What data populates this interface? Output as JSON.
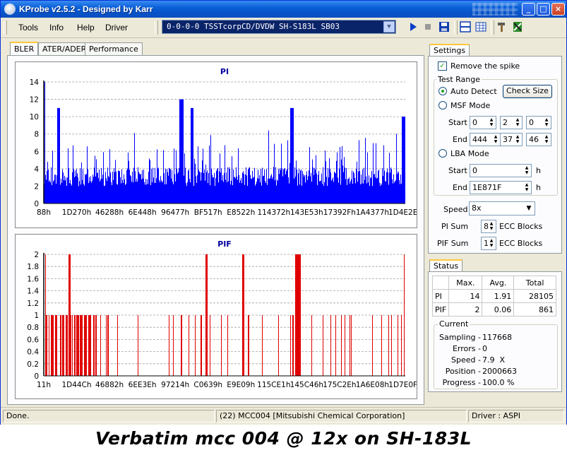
{
  "window": {
    "title": "KProbe v2.5.2 - Designed by Karr"
  },
  "menu": {
    "items": [
      "Tools",
      "Info",
      "Help",
      "Driver"
    ]
  },
  "toolbar": {
    "drive": "0-0-0-0 TSSTcorpCD/DVDW SH-S183L SB03"
  },
  "tabs": [
    "BLER",
    "ATER/ADER",
    "Performance"
  ],
  "pi_chart": {
    "title": "PI",
    "yticks": [
      "0",
      "2",
      "4",
      "6",
      "8",
      "10",
      "12",
      "14"
    ],
    "xticks": [
      "88h",
      "1D270h",
      "46288h",
      "6E448h",
      "96477h",
      "BF517h",
      "E8522h",
      "114372h",
      "143E53h",
      "17392Fh",
      "1A4377h",
      "1D4E2Eh"
    ],
    "color": "#0000ff"
  },
  "pif_chart": {
    "title": "PIF",
    "yticks": [
      "0",
      "0.2",
      "0.4",
      "0.6",
      "0.8",
      "1",
      "1.2",
      "1.4",
      "1.6",
      "1.8",
      "2"
    ],
    "xticks": [
      "11h",
      "1D44Ch",
      "46882h",
      "6EE3Eh",
      "97214h",
      "C0639h",
      "E9E09h",
      "115CE1h",
      "145C46h",
      "175C2Eh",
      "1A6E08h",
      "1D7E0Fh"
    ],
    "color": "#e00000"
  },
  "chart_data": [
    {
      "type": "area",
      "title": "PI",
      "ylim": [
        0,
        14
      ],
      "x_ticks": [
        "88h",
        "1D270h",
        "46288h",
        "6E448h",
        "96477h",
        "BF517h",
        "E8522h",
        "114372h",
        "143E53h",
        "17392Fh",
        "1A4377h",
        "1D4E2Eh"
      ],
      "baseline_range": [
        2,
        5
      ],
      "peaks": [
        {
          "x": "88h",
          "value": 14
        },
        {
          "x": "1D270h",
          "value": 11
        },
        {
          "x": "BF517h",
          "value": 12
        },
        {
          "x": "143E53h",
          "value": 11
        },
        {
          "x": "1D4E2Eh",
          "value": 10
        }
      ],
      "grid": true
    },
    {
      "type": "bar",
      "title": "PIF",
      "ylim": [
        0,
        2
      ],
      "x_ticks": [
        "11h",
        "1D44Ch",
        "46882h",
        "6EE3Eh",
        "97214h",
        "C0639h",
        "E9E09h",
        "115CE1h",
        "145C46h",
        "175C2Eh",
        "1A6E08h",
        "1D7E0Fh"
      ],
      "levels": [
        1,
        2
      ],
      "grid": true
    }
  ],
  "settings": {
    "tab": "Settings",
    "remove_spike": "Remove the spike",
    "test_range": "Test Range",
    "auto_detect": "Auto Detect",
    "check_size": "Check Size",
    "msf_mode": "MSF Mode",
    "start": "Start",
    "end": "End",
    "msf_start": [
      "0",
      "2",
      "0"
    ],
    "msf_end": [
      "444",
      "37",
      "46"
    ],
    "lba_mode": "LBA Mode",
    "lba_start": "0",
    "lba_end": "1E871F",
    "unit_h": "h",
    "speed_label": "Speed",
    "speed_value": "8x",
    "pi_sum_label": "PI Sum",
    "pi_sum_value": "8",
    "pif_sum_label": "PIF Sum",
    "pif_sum_value": "1",
    "ecc_blocks": "ECC Blocks"
  },
  "status": {
    "tab": "Status",
    "headers": [
      "",
      "Max.",
      "Avg.",
      "Total"
    ],
    "rows": [
      [
        "PI",
        "14",
        "1.91",
        "28105"
      ],
      [
        "PIF",
        "2",
        "0.06",
        "861"
      ]
    ],
    "current_title": "Current",
    "current": [
      {
        "label": "Sampling -",
        "value": "117668"
      },
      {
        "label": "Errors -",
        "value": "0"
      },
      {
        "label": "Speed -",
        "value": "7.9  X"
      },
      {
        "label": "Position -",
        "value": "2000663"
      },
      {
        "label": "Progress -",
        "value": "100.0 %"
      }
    ]
  },
  "statusbar": {
    "left": "Done.",
    "middle": "(22) MCC004 [Mitsubishi Chemical Corporation]",
    "right": "Driver : ASPI"
  },
  "caption": "Verbatim mcc 004 @ 12x on SH-183L"
}
